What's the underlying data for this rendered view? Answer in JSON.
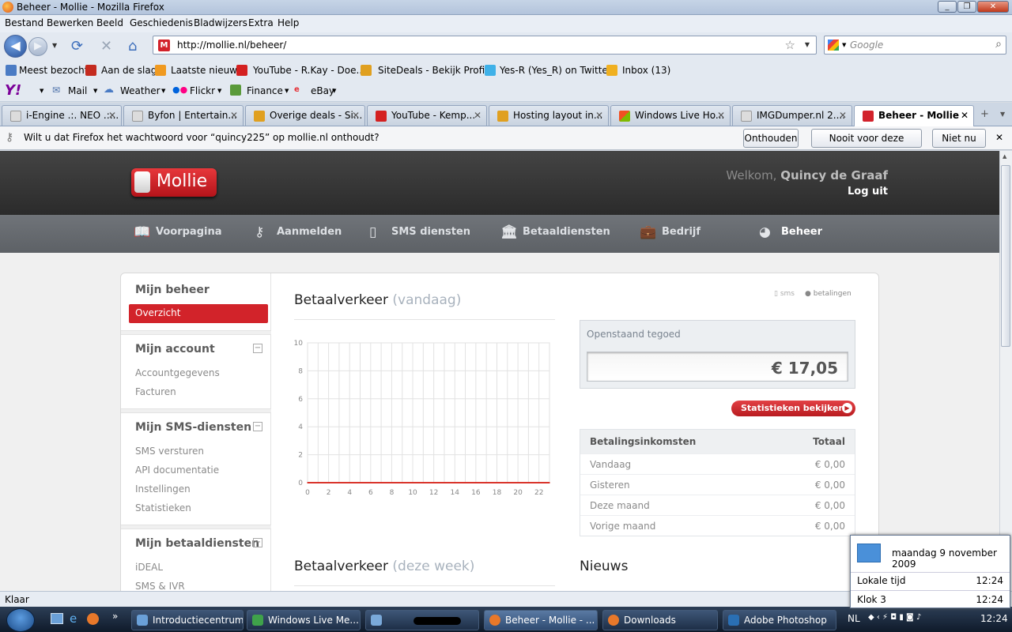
{
  "window": {
    "title": "Beheer - Mollie - Mozilla Firefox"
  },
  "menu": [
    "Bestand",
    "Bewerken",
    "Beeld",
    "Geschiedenis",
    "Bladwijzers",
    "Extra",
    "Help"
  ],
  "nav": {
    "url": "http://mollie.nl/beheer/",
    "search_placeholder": "Google"
  },
  "bookmarks": [
    {
      "label": "Meest bezocht",
      "color": "#4a7bc4"
    },
    {
      "label": "Aan de slag",
      "color": "#c42b1f"
    },
    {
      "label": "Laatste nieuws",
      "color": "#f09a20"
    },
    {
      "label": "YouTube - R.Kay - Doe...",
      "color": "#d42020"
    },
    {
      "label": "SiteDeals - Bekijk Profi...",
      "color": "#e0a020"
    },
    {
      "label": "Yes-R (Yes_R) on Twitter",
      "color": "#3fb1e8"
    },
    {
      "label": "Inbox (13)",
      "color": "#f0b020"
    }
  ],
  "yahoo": {
    "logo": "Y!",
    "items": [
      "Mail",
      "Weather",
      "Flickr",
      "Finance",
      "eBay"
    ]
  },
  "tabs": [
    {
      "label": "i-Engine .:. NEO .:...",
      "color": "#dcdcdc"
    },
    {
      "label": "Byfon | Entertain...",
      "color": "#dcdcdc"
    },
    {
      "label": "Overige deals - Si...",
      "color": "#e0a020"
    },
    {
      "label": "YouTube - Kemp...",
      "color": "#d42020"
    },
    {
      "label": "Hosting layout in...",
      "color": "#e0a020"
    },
    {
      "label": "Windows Live Ho...",
      "color": "#f3b316"
    },
    {
      "label": "IMGDumper.nl 2....",
      "color": "#dcdcdc"
    },
    {
      "label": "Beheer - Mollie",
      "color": "#d2222b"
    }
  ],
  "notification": {
    "text": "Wilt u dat Firefox het wachtwoord voor “quincy225” op mollie.nl onthoudt?",
    "buttons": [
      "Onthouden",
      "Nooit voor deze website",
      "Niet nu"
    ]
  },
  "site": {
    "logo": "Mollie",
    "welcome_prefix": "Welkom,",
    "user": "Quincy de Graaf",
    "logout": "Log uit",
    "nav": [
      "Voorpagina",
      "Aanmelden",
      "SMS diensten",
      "Betaaldiensten",
      "Bedrijf",
      "Beheer"
    ]
  },
  "sidebar": {
    "beheer_title": "Mijn beheer",
    "overzicht": "Overzicht",
    "account_title": "Mijn account",
    "account_items": [
      "Accountgegevens",
      "Facturen"
    ],
    "sms_title": "Mijn SMS-diensten",
    "sms_items": [
      "SMS versturen",
      "API documentatie",
      "Instellingen",
      "Statistieken"
    ],
    "betaal_title": "Mijn betaaldiensten",
    "betaal_items": [
      "iDEAL",
      "SMS & IVR"
    ]
  },
  "main": {
    "chart_title": "Betaalverkeer",
    "chart_sub": "(vandaag)",
    "filter_sms": "sms",
    "filter_betalingen": "betalingen",
    "saldo_label": "Openstaand tegoed",
    "saldo_value": "€ 17,05",
    "stats_button": "Statistieken bekijken",
    "income_header": "Betalingsinkomsten",
    "income_total_header": "Totaal",
    "income_rows": [
      {
        "k": "Vandaag",
        "v": "€ 0,00"
      },
      {
        "k": "Gisteren",
        "v": "€ 0,00"
      },
      {
        "k": "Deze maand",
        "v": "€ 0,00"
      },
      {
        "k": "Vorige maand",
        "v": "€ 0,00"
      }
    ],
    "week_title": "Betaalverkeer",
    "week_sub": "(deze week)",
    "news_title": "Nieuws"
  },
  "chart_data": {
    "type": "line",
    "x": [
      0,
      1,
      2,
      3,
      4,
      5,
      6,
      7,
      8,
      9,
      10,
      11,
      12,
      13,
      14,
      15,
      16,
      17,
      18,
      19,
      20,
      21,
      22,
      23
    ],
    "x_ticks": [
      0,
      2,
      4,
      6,
      8,
      10,
      12,
      14,
      16,
      18,
      20,
      22
    ],
    "y_ticks": [
      0,
      2,
      4,
      6,
      8,
      10
    ],
    "ylim": [
      0,
      10
    ],
    "series": [
      {
        "values": [
          0,
          0,
          0,
          0,
          0,
          0,
          0,
          0,
          0,
          0,
          0,
          0,
          0,
          0,
          0,
          0,
          0,
          0,
          0,
          0,
          0,
          0,
          0,
          0
        ],
        "color": "#d9342b"
      }
    ],
    "grid": true
  },
  "status": {
    "text": "Klaar"
  },
  "taskbar": {
    "tasks": [
      {
        "label": "Introductiecentrum",
        "color": "#6aa0d8"
      },
      {
        "label": "Windows Live Me...",
        "color": "#3fa24a"
      },
      {
        "label": "",
        "color": "#7aa9d9"
      },
      {
        "label": "Beheer - Mollie - ...",
        "color": "#e8782a"
      },
      {
        "label": "Downloads",
        "color": "#e8782a"
      },
      {
        "label": "Adobe Photoshop",
        "color": "#2a6fb4"
      }
    ],
    "lang": "NL",
    "time": "12:24"
  },
  "clock": {
    "date": "maandag 9 november 2009",
    "rows": [
      {
        "k": "Lokale tijd",
        "v": "12:24"
      },
      {
        "k": "Klok 3",
        "v": "12:24"
      }
    ]
  }
}
